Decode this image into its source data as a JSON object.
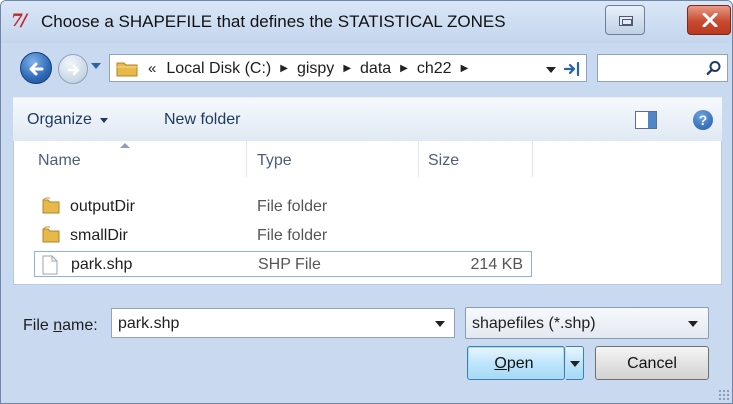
{
  "window": {
    "title": "Choose a SHAPEFILE that defines the STATISTICAL ZONES",
    "app_icon": "tk-feather-icon"
  },
  "address_bar": {
    "lead_glyph": "«",
    "breadcrumbs": [
      "Local Disk (C:)",
      "gispy",
      "data",
      "ch22"
    ],
    "search_placeholder": ""
  },
  "toolbar": {
    "organize_label": "Organize",
    "new_folder_label": "New folder"
  },
  "file_list": {
    "columns": [
      "Name",
      "Type",
      "Size"
    ],
    "rows": [
      {
        "name": "outputDir",
        "type": "File folder",
        "size": "",
        "icon": "folder-icon"
      },
      {
        "name": "smallDir",
        "type": "File folder",
        "size": "",
        "icon": "folder-icon"
      },
      {
        "name": "park.shp",
        "type": "SHP File",
        "size": "214 KB",
        "icon": "file-icon",
        "selected": true
      }
    ]
  },
  "bottom": {
    "file_name_label_pre": "File ",
    "file_name_label_accel": "n",
    "file_name_label_post": "ame:",
    "file_name_value": "park.shp",
    "filter_value": "shapefiles (*.shp)",
    "open_label_accel": "O",
    "open_label_rest": "pen",
    "cancel_label": "Cancel"
  },
  "colors": {
    "frame": "#c9daf0",
    "close_button": "#c84a2f",
    "accent_blue": "#2d69b8",
    "folder_yellow": "#e7b84a"
  }
}
